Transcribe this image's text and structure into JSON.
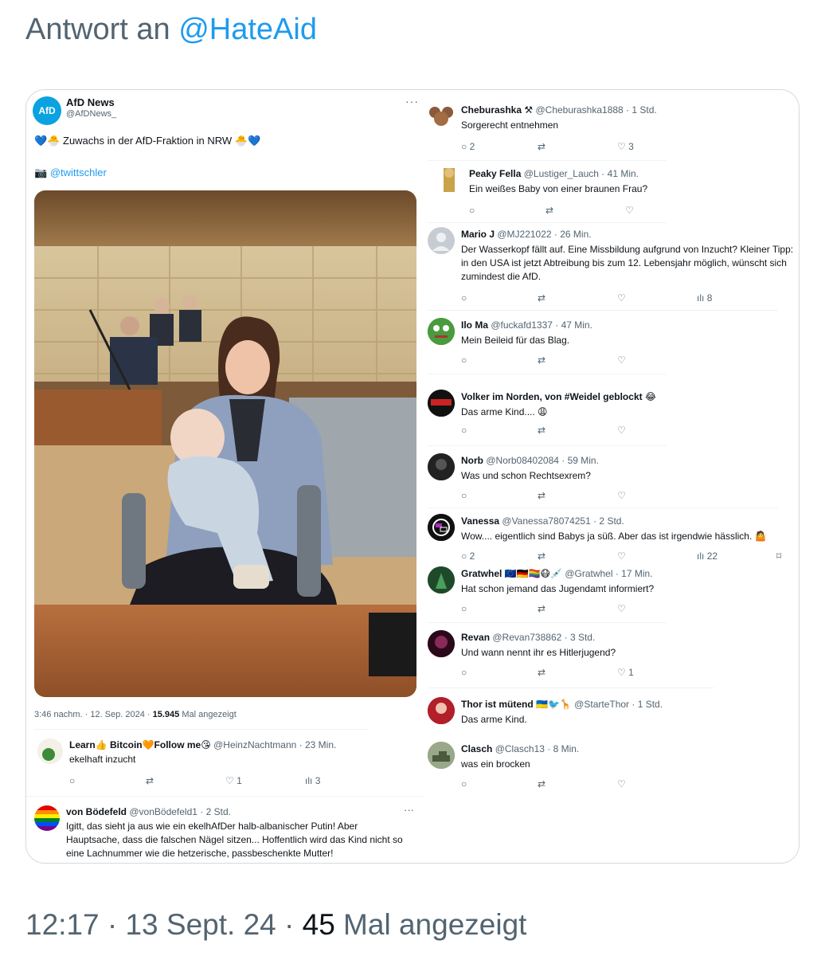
{
  "reply_header": {
    "prefix": "Antwort an",
    "mention": "@HateAid"
  },
  "main_tweet": {
    "avatar_text": "AfD",
    "name": "AfD News",
    "handle": "@AfDNews_",
    "more": "···",
    "text": "Zuwachs in der AfD-Fraktion in NRW",
    "emoji_left": "💙🐣",
    "emoji_right": "🐣💙",
    "credit_icon": "📷",
    "credit": "@twittschler",
    "time": "3:46 nachm. · 12. Sep. 2024 · ",
    "views_count": "15.945",
    "views_label": "Mal angezeigt"
  },
  "left_replies": [
    {
      "name": "Learn👍 Bitcoin🧡Follow me😘",
      "handle": "@HeinzNachtmann · 23 Min.",
      "text": "ekelhaft inzucht",
      "likes": "1",
      "views": "3"
    },
    {
      "name": "von Bödefeld",
      "handle": "@vonBödefeld1 · 2 Std.",
      "more": "···",
      "text": "Igitt, das sieht ja aus wie ein ekelhAfDer halb-albanischer Putin! Aber Hauptsache, dass die falschen Nägel sitzen... Hoffentlich wird das Kind nicht so eine Lachnummer wie die hetzerische, passbeschenkte Mutter!"
    }
  ],
  "right_replies": [
    {
      "name": "Cheburashka ⚒",
      "handle": "@Cheburashka1888 · 1 Std.",
      "text": "Sorgerecht entnehmen",
      "replies": "2",
      "likes": "3",
      "views": "",
      "avatar_color": "#8a5a3a"
    },
    {
      "name": "Peaky Fella",
      "handle": "@Lustiger_Lauch · 41 Min.",
      "text": "Ein weißes Baby von einer braunen Frau?",
      "replies": "",
      "likes": "",
      "views": "",
      "avatar_color": "#c9a24a"
    },
    {
      "name": "Mario J",
      "handle": "@MJ221022 · 26 Min.",
      "text": "Der Wasserkopf fällt auf. Eine Missbildung aufgrund von Inzucht? Kleiner Tipp: in den USA ist jetzt Abtreibung bis zum 12. Lebensjahr möglich, wünscht sich zumindest die AfD.",
      "replies": "",
      "likes": "",
      "views": "8",
      "avatar_color": "#c6ccd1"
    },
    {
      "name": "Ilo Ma",
      "handle": "@fuckafd1337 · 47 Min.",
      "text": "Mein Beileid für das Blag.",
      "replies": "",
      "likes": "",
      "views": "",
      "avatar_color": "#3f8a3a"
    },
    {
      "name": "Volker im Norden, von #Weidel geblockt 😂",
      "handle": "",
      "text": "Das arme Kind.... 😩",
      "replies": "",
      "likes": "",
      "views": "",
      "avatar_color": "#1a1a1a"
    },
    {
      "name": "Norb",
      "handle": "@Norb08402084 · 59 Min.",
      "text": "Was und schon Rechtsexrem?",
      "replies": "",
      "likes": "",
      "views": "",
      "avatar_color": "#2a2a2a"
    },
    {
      "name": "Vanessa",
      "handle": "@Vanessa78074251 · 2 Std.",
      "text": "Wow.... eigentlich sind Babys ja süß. Aber das ist irgendwie hässlich. 🤷",
      "replies": "2",
      "likes": "",
      "views": "22",
      "avatar_color": "#111111"
    },
    {
      "name": "Gratwhel 🇪🇺🇩🇪🏳️‍🌈😷💉",
      "handle": "@Gratwhel · 17 Min.",
      "text": "Hat schon jemand das Jugendamt informiert?",
      "replies": "",
      "likes": "",
      "views": "",
      "avatar_color": "#2f6b3f"
    },
    {
      "name": "Revan",
      "handle": "@Revan738862 · 3 Std.",
      "text": "Und wann nennt ihr es Hitlerjugend?",
      "replies": "",
      "likes": "1",
      "views": "",
      "avatar_color": "#5a1a3a"
    },
    {
      "name": "Thor ist mütend 🇺🇦🐦🦒",
      "handle": "@StarteThor · 1 Std.",
      "text": "Das arme Kind.",
      "replies": "",
      "likes": "",
      "views": "",
      "avatar_color": "#b21e2a"
    },
    {
      "name": "Clasch",
      "handle": "@Clasch13 · 8 Min.",
      "text": "was ein brocken",
      "replies": "",
      "likes": "",
      "views": "",
      "avatar_color": "#6b8a5a"
    }
  ],
  "footer": {
    "time": "12:17 · 13 Sept. 24 · ",
    "views_count": "45",
    "views_label": " Mal angezeigt"
  },
  "icons": {
    "reply": "○",
    "retweet": "⇄",
    "like": "♡",
    "views": "ılı",
    "bookmark": "⌑"
  }
}
